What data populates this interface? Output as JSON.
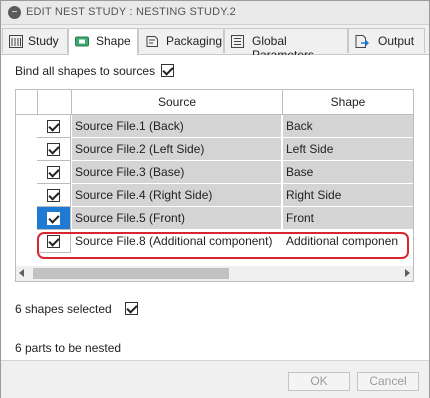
{
  "window": {
    "title": "EDIT NEST STUDY : NESTING STUDY.2",
    "title_icon": "minus-circle-icon"
  },
  "tabs": [
    {
      "label": "Study",
      "icon": "study-icon",
      "active": false
    },
    {
      "label": "Shape",
      "icon": "shape-icon",
      "active": true
    },
    {
      "label": "Packaging",
      "icon": "packaging-icon",
      "active": false
    },
    {
      "label": "Global Parameters",
      "icon": "global-parameters-icon",
      "active": false
    },
    {
      "label": "Output",
      "icon": "output-icon",
      "active": false
    }
  ],
  "bind_all": {
    "label": "Bind all shapes to sources",
    "checked": true
  },
  "table": {
    "columns": [
      "Source",
      "Shape"
    ],
    "rows": [
      {
        "checked": true,
        "source": "Source File.1 (Back)",
        "shape": "Back",
        "selected": false
      },
      {
        "checked": true,
        "source": "Source File.2 (Left Side)",
        "shape": "Left Side",
        "selected": false
      },
      {
        "checked": true,
        "source": "Source File.3 (Base)",
        "shape": "Base",
        "selected": false
      },
      {
        "checked": true,
        "source": "Source File.4 (Right Side)",
        "shape": "Right Side",
        "selected": false
      },
      {
        "checked": true,
        "source": "Source File.5 (Front)",
        "shape": "Front",
        "selected": true
      },
      {
        "checked": true,
        "source": "Source File.8 (Additional component)",
        "shape": "Additional componen",
        "selected": false
      }
    ]
  },
  "shapes_selected": {
    "label": "6 shapes selected",
    "checked": true
  },
  "parts_label": "6 parts to be nested",
  "buttons": {
    "ok": "OK",
    "cancel": "Cancel"
  },
  "colors": {
    "selection": "#1e7ad2",
    "highlight_border": "#d8262e",
    "cell_fill": "#d4d4d4"
  }
}
